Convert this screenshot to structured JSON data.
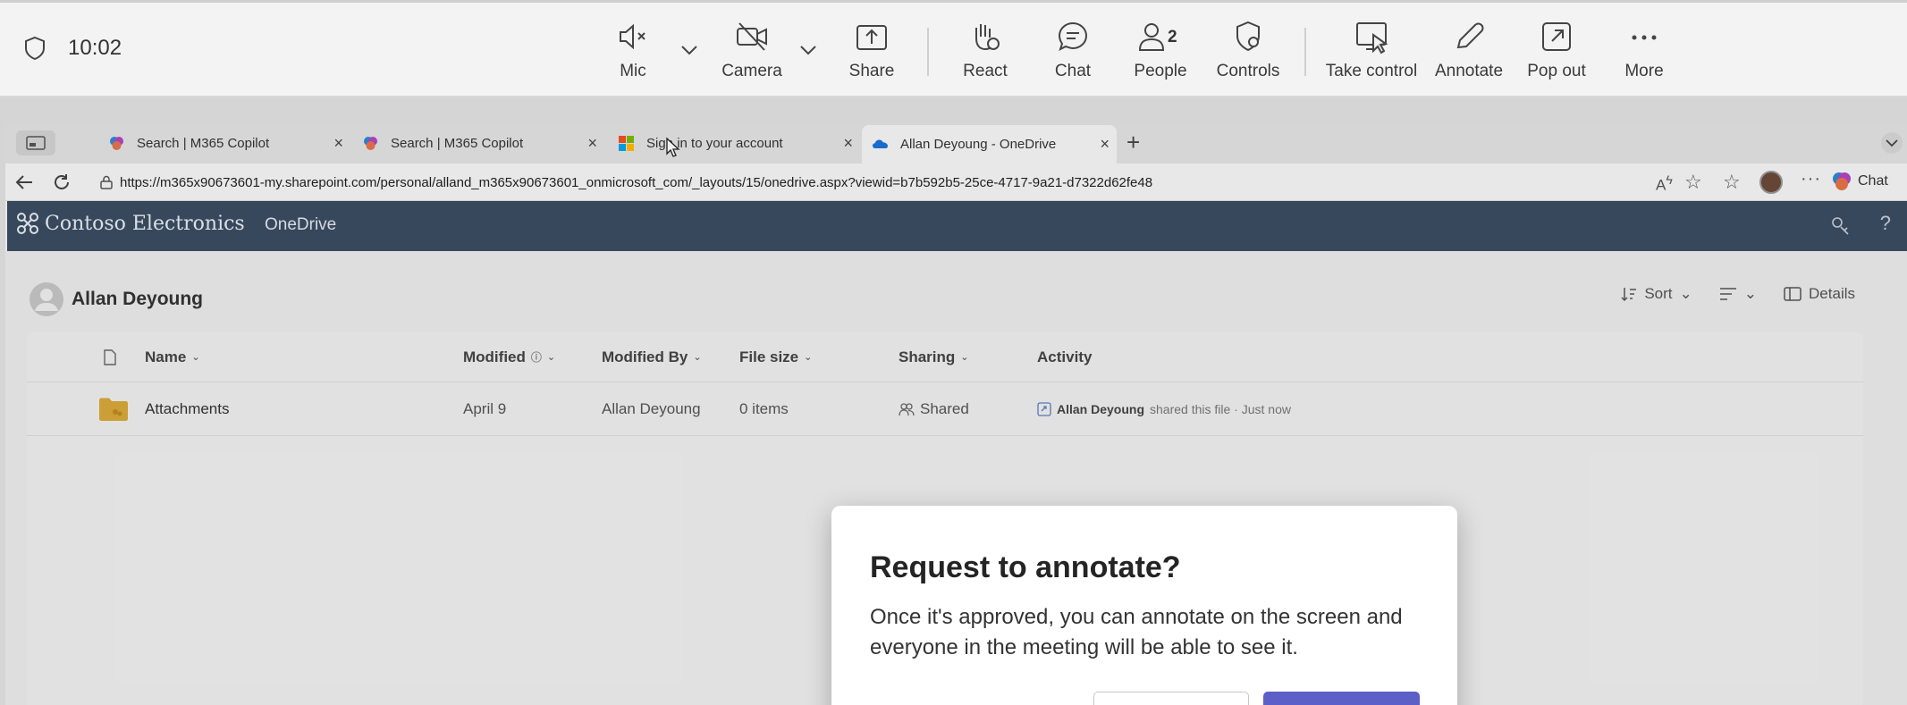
{
  "meeting": {
    "timer": "10:02",
    "people_count": "2",
    "tools": {
      "mic": "Mic",
      "camera": "Camera",
      "share": "Share",
      "react": "React",
      "chat": "Chat",
      "people": "People",
      "controls": "Controls",
      "take_control": "Take control",
      "annotate": "Annotate",
      "pop_out": "Pop out",
      "more": "More"
    }
  },
  "browser": {
    "tabs": [
      {
        "title": "Search | M365 Copilot",
        "icon": "copilot-icon"
      },
      {
        "title": "Search | M365 Copilot",
        "icon": "copilot-icon"
      },
      {
        "title": "Sign in to your account",
        "icon": "microsoft-logo-icon"
      },
      {
        "title": "Allan Deyoung - OneDrive",
        "icon": "onedrive-icon",
        "active": true
      }
    ],
    "url": "https://m365x90673601-my.sharepoint.com/personal/alland_m365x90673601_onmicrosoft_com/_layouts/15/onedrive.aspx?viewid=b7b592b5-25ce-4717-9a21-d7322d62fe48",
    "chat_label": "Chat"
  },
  "sharepoint": {
    "brand": "Contoso Electronics",
    "app": "OneDrive",
    "owner": "Allan Deyoung",
    "commands": {
      "sort": "Sort",
      "details": "Details"
    },
    "columns": {
      "name": "Name",
      "modified": "Modified",
      "modified_by": "Modified By",
      "file_size": "File size",
      "sharing": "Sharing",
      "activity": "Activity"
    },
    "rows": [
      {
        "name": "Attachments",
        "modified": "April 9",
        "modified_by": "Allan Deyoung",
        "file_size": "0 items",
        "sharing": "Shared",
        "activity_user": "Allan Deyoung",
        "activity_text": "shared this file · Just now"
      }
    ]
  },
  "dialog": {
    "title": "Request to annotate?",
    "body": "Once it's approved, you can annotate on the screen and everyone in the meeting will be able to see it.",
    "accent": "#5b5fc7"
  }
}
